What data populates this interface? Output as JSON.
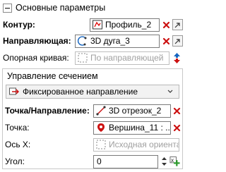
{
  "group": {
    "title": "Основные параметры"
  },
  "contour": {
    "label": "Контур:",
    "value": "Профиль_2"
  },
  "guide": {
    "label": "Направляющая:",
    "value": "3D дуга_3"
  },
  "support_curve": {
    "label": "Опорная кривая:",
    "placeholder": "По направляющей"
  },
  "section_control": {
    "title": "Управление сечением",
    "mode_value": "Фиксированное направление",
    "point_direction": {
      "label": "Точка/Направление:",
      "value": "3D отрезок_2"
    },
    "point": {
      "label": "Точка:",
      "value": "Вершина_11 : ..."
    },
    "x_axis": {
      "label": "Ось X:",
      "placeholder": "Исходная ориентаци"
    },
    "angle": {
      "label": "Угол:",
      "value": "0"
    }
  },
  "colors": {
    "clear_red": "#cc1111",
    "accent_blue": "#1565c0",
    "green": "#2e9b2e"
  }
}
